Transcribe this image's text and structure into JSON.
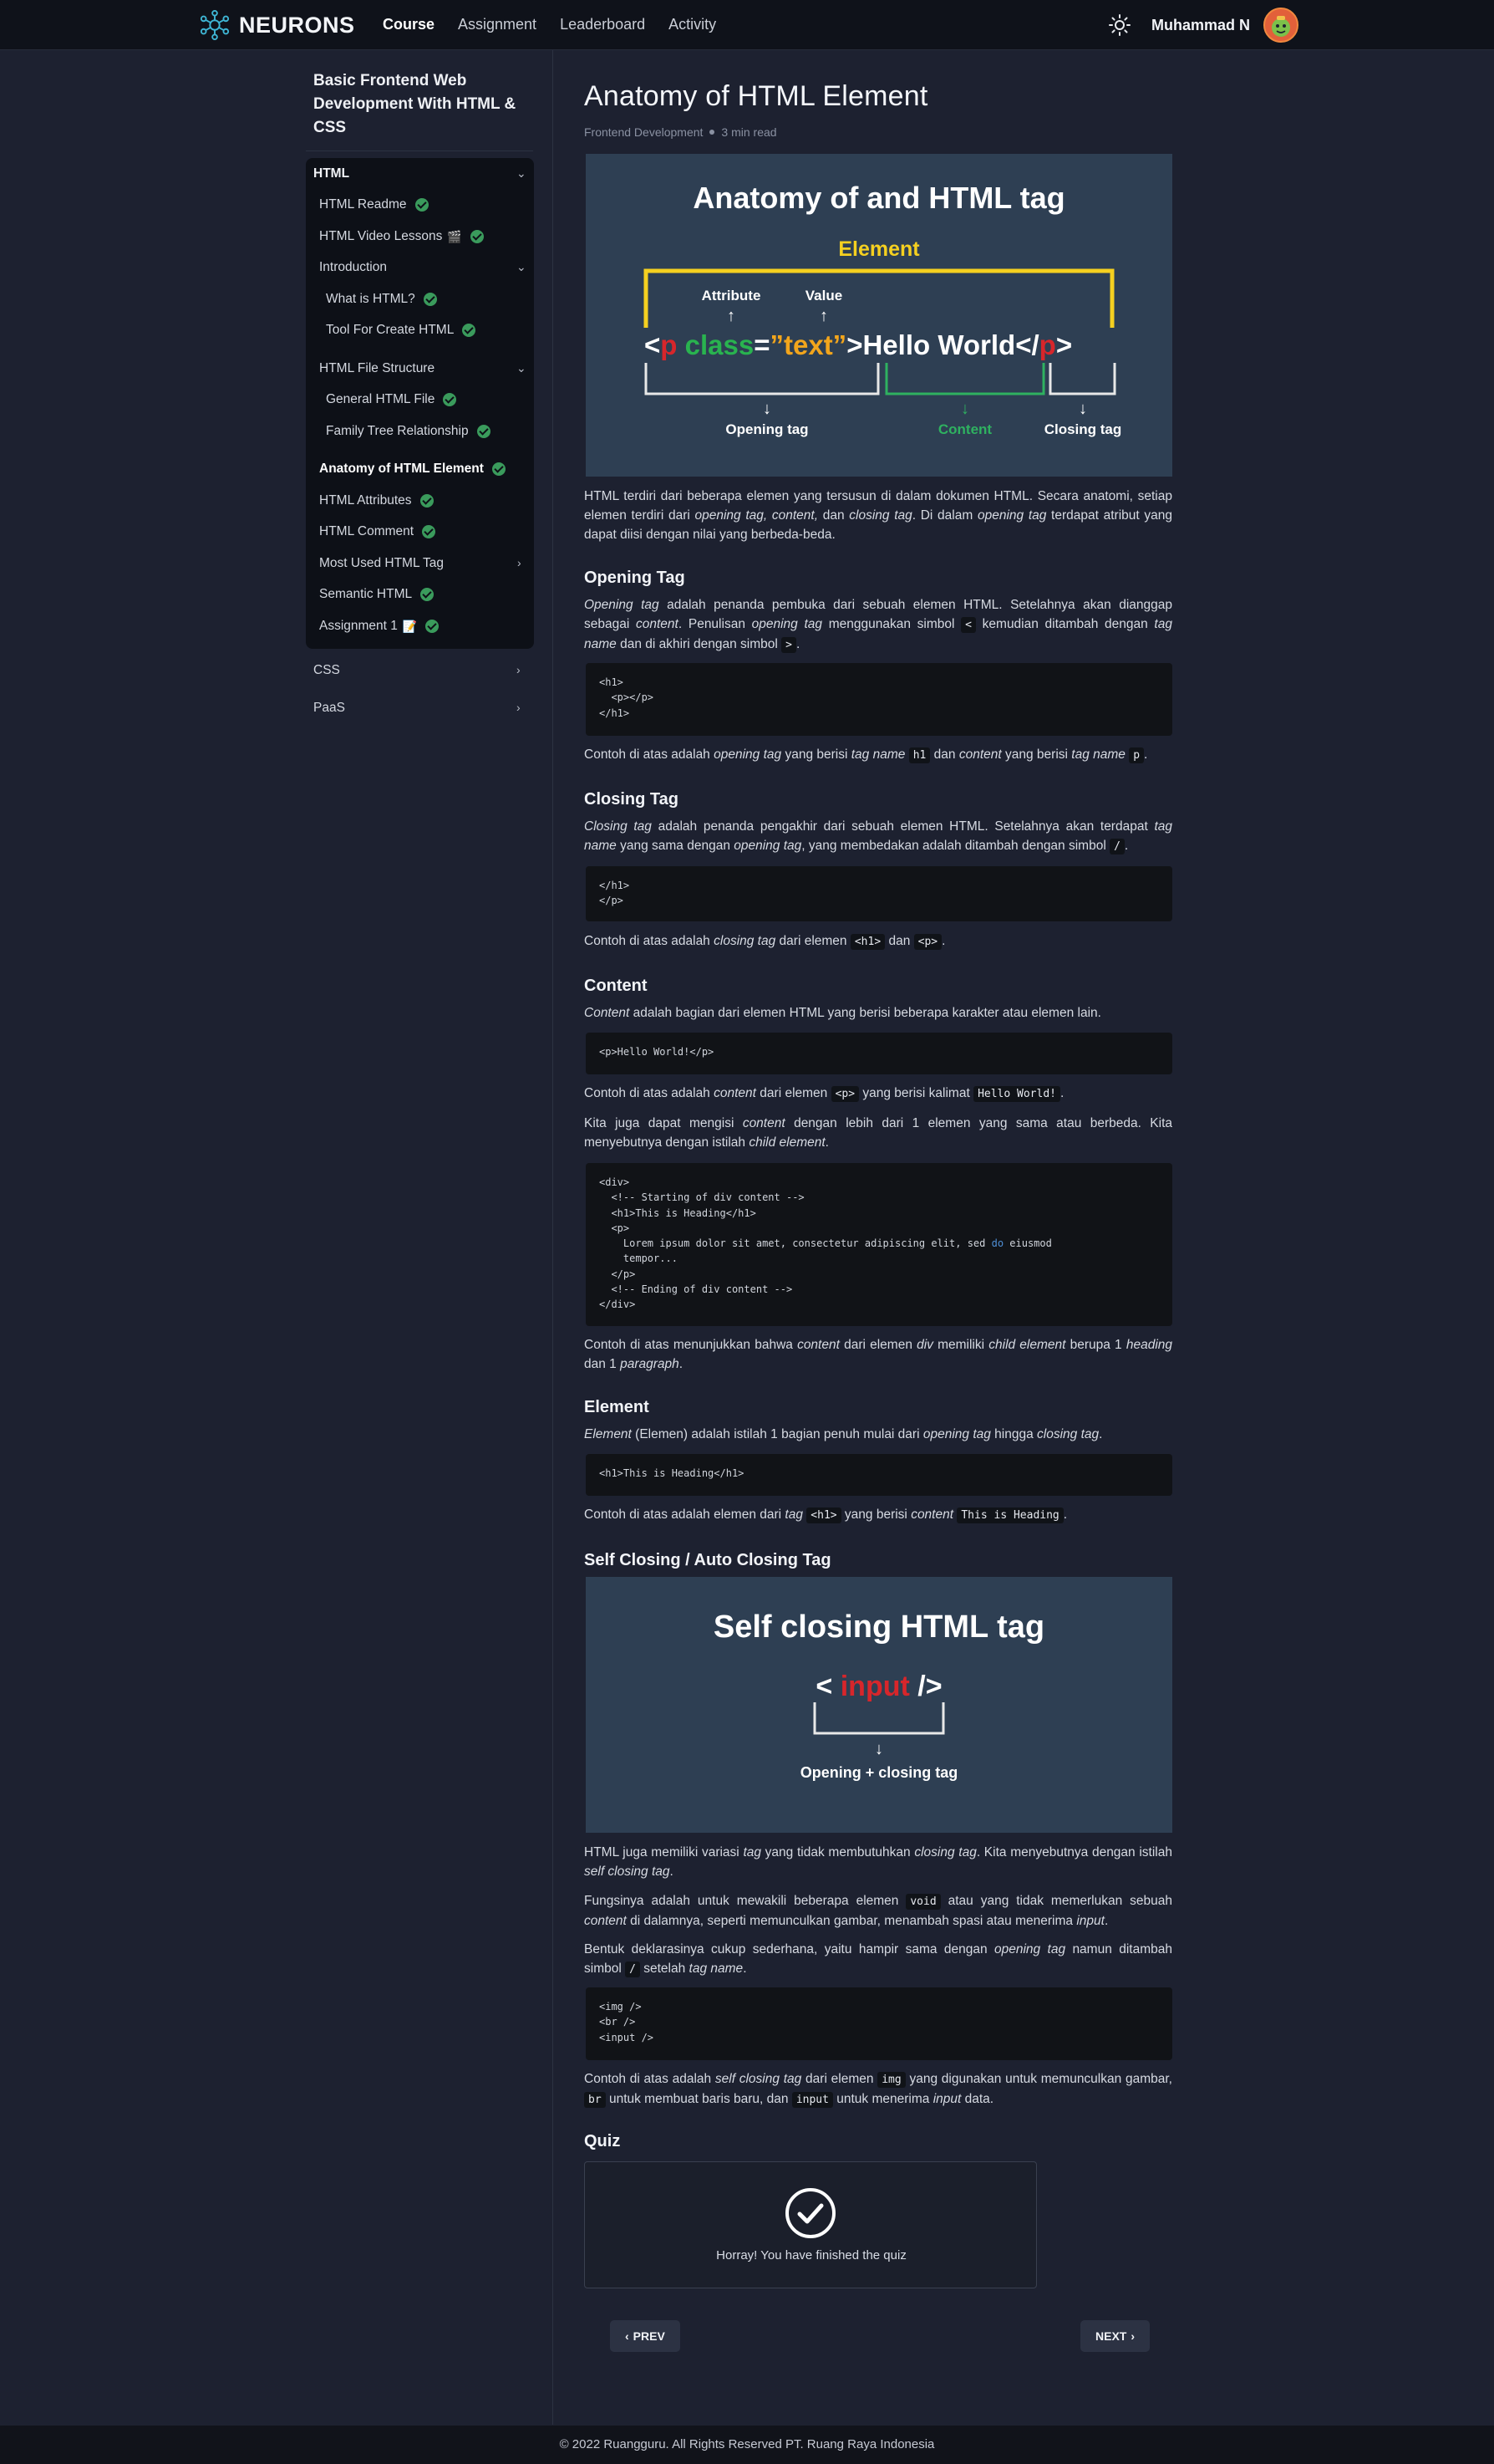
{
  "nav": {
    "brand": "NEURONS",
    "links": [
      "Course",
      "Assignment",
      "Leaderboard",
      "Activity"
    ],
    "username": "Muhammad N"
  },
  "sidebar": {
    "course_title": "Basic Frontend Web Development With HTML & CSS",
    "html_section": "HTML",
    "items": {
      "readme": "HTML Readme",
      "video": "HTML Video Lessons",
      "video_glyph": "🎬",
      "intro": "Introduction",
      "what_is": "What is HTML?",
      "tool": "Tool For Create HTML",
      "file_structure": "HTML File Structure",
      "general": "General HTML File",
      "family": "Family Tree Relationship",
      "anatomy": "Anatomy of HTML Element",
      "attributes": "HTML Attributes",
      "comment": "HTML Comment",
      "most_used": "Most Used HTML Tag",
      "semantic": "Semantic HTML",
      "assignment": "Assignment 1",
      "assignment_glyph": "📝"
    },
    "css_section": "CSS",
    "paas_section": "PaaS"
  },
  "article": {
    "title": "Anatomy of HTML Element",
    "category": "Frontend Development",
    "read_time": "3 min read",
    "fig1": {
      "title": "Anatomy of and HTML tag",
      "element_label": "Element",
      "attribute_label": "Attribute",
      "value_label": "Value",
      "lt": "<",
      "tag_p": "p",
      "attr_name": "class",
      "eq": "=",
      "attr_value": "”text”",
      "gt": ">",
      "content_text": "Hello World",
      "close_open": "</",
      "close_tag": "p",
      "close_gt": ">",
      "opening_label": "Opening tag",
      "content_label": "Content",
      "closing_label": "Closing tag"
    },
    "fig2": {
      "title": "Self closing HTML tag",
      "lt": "<",
      "tag": "input",
      "end": "/>",
      "label": "Opening + closing tag"
    },
    "sections": {
      "opening": "Opening Tag",
      "closing": "Closing Tag",
      "content": "Content",
      "element": "Element",
      "self": "Self Closing / Auto Closing Tag",
      "quiz": "Quiz"
    },
    "code": {
      "c1": "<h1>\n  <p></p>\n</h1>",
      "c2": "</h1>\n</p>",
      "c3": "<p>Hello World!</p>",
      "c4a": "<div>\n  <!-- Starting of div content -->\n  <h1>This is Heading</h1>\n  <p>\n    Lorem ipsum dolor sit amet, consectetur adipiscing elit, sed ",
      "c4kw": "do",
      "c4b": " eiusmod\n    tempor...\n  </p>\n  <!-- Ending of div content -->\n</div>",
      "c5": "<h1>This is Heading</h1>",
      "c6": "<img />\n<br />\n<input />"
    },
    "quiz_text": "Horray! You have finished the quiz",
    "prev": "PREV",
    "next": "NEXT"
  },
  "footer": "© 2022 Ruangguru. All Rights Reserved PT. Ruang Raya Indonesia"
}
